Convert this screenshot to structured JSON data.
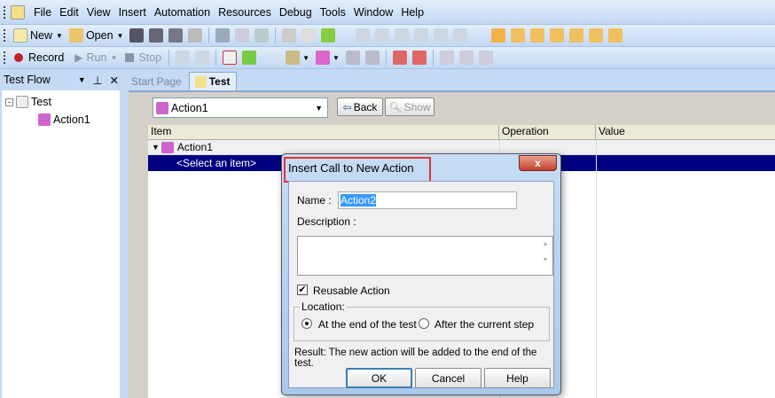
{
  "menu": [
    "File",
    "Edit",
    "View",
    "Insert",
    "Automation",
    "Resources",
    "Debug",
    "Tools",
    "Window",
    "Help"
  ],
  "toolbar1": {
    "new": "New",
    "open": "Open"
  },
  "toolbar2": {
    "record": "Record",
    "run": "Run",
    "stop": "Stop"
  },
  "testflow": {
    "title": "Test Flow",
    "root": "Test",
    "child": "Action1"
  },
  "tabs": [
    "Start Page",
    "Test"
  ],
  "editor": {
    "action_select": "Action1",
    "back": "Back",
    "show": "Show",
    "columns": [
      "Item",
      "Operation",
      "Value"
    ],
    "rows": [
      "Action1",
      "<Select an item>"
    ]
  },
  "dialog": {
    "title": "Insert Call to New Action",
    "name_label": "Name :",
    "name_value": "Action2",
    "description_label": "Description :",
    "reusable_label": "Reusable Action",
    "reusable_checked": true,
    "location_label": "Location:",
    "opt_end": "At the end of the test",
    "opt_after": "After the current step",
    "selected_option": "end",
    "result": "Result: The new action will be added to the end of the test.",
    "ok": "OK",
    "cancel": "Cancel",
    "help": "Help",
    "close": "x"
  },
  "colors": {
    "selection": "#000080",
    "highlight_box": "#e8303a"
  }
}
